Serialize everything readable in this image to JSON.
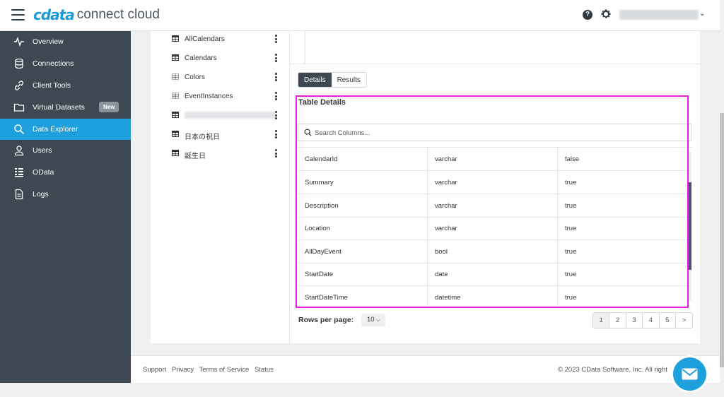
{
  "header": {
    "logo_brand": "cdata",
    "logo_text": "connect cloud",
    "help": "?",
    "user_chevron": "⌄"
  },
  "sidebar": {
    "items": [
      {
        "label": "Overview",
        "icon": "pulse-icon"
      },
      {
        "label": "Connections",
        "icon": "database-icon"
      },
      {
        "label": "Client Tools",
        "icon": "link-icon"
      },
      {
        "label": "Virtual Datasets",
        "icon": "folder-icon",
        "badge": "New"
      },
      {
        "label": "Data Explorer",
        "icon": "search-icon",
        "active": true
      },
      {
        "label": "Users",
        "icon": "user-icon"
      },
      {
        "label": "OData",
        "icon": "odata-icon"
      },
      {
        "label": "Logs",
        "icon": "document-icon"
      }
    ]
  },
  "tree": {
    "items": [
      {
        "label": "AllCalendars",
        "icon": "table-icon"
      },
      {
        "label": "Calendars",
        "icon": "table-icon"
      },
      {
        "label": "Colors",
        "icon": "view-icon"
      },
      {
        "label": "EventInstances",
        "icon": "view-icon"
      },
      {
        "label": "",
        "icon": "table-icon"
      },
      {
        "label": "日本の祝日",
        "icon": "table-icon"
      },
      {
        "label": "誕生日",
        "icon": "table-icon"
      }
    ]
  },
  "tabs": {
    "details": "Details",
    "results": "Results"
  },
  "details": {
    "title": "Table Details",
    "search_placeholder": "Search Columns...",
    "rows": [
      [
        "CalendarId",
        "varchar",
        "false"
      ],
      [
        "Summary",
        "varchar",
        "true"
      ],
      [
        "Description",
        "varchar",
        "true"
      ],
      [
        "Location",
        "varchar",
        "true"
      ],
      [
        "AllDayEvent",
        "bool",
        "true"
      ],
      [
        "StartDate",
        "date",
        "true"
      ],
      [
        "StartDateTime",
        "datetime",
        "true"
      ]
    ]
  },
  "pagination": {
    "rows_per_page_label": "Rows per page:",
    "rows_per_page_value": "10",
    "pages": [
      "1",
      "2",
      "3",
      "4",
      "5",
      ">"
    ]
  },
  "footer": {
    "links": [
      "Support",
      "Privacy",
      "Terms of Service",
      "Status"
    ],
    "copyright": "© 2023 CData Software, Inc. All right"
  },
  "colors": {
    "accent": "#1ea0dc",
    "sidebar_bg": "#3d4852",
    "highlight": "#e81ce0"
  }
}
